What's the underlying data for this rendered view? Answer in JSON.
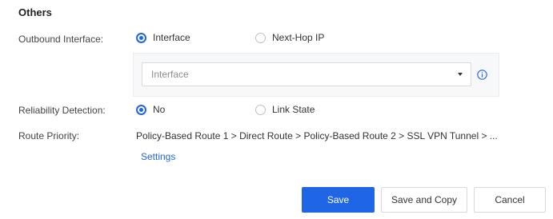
{
  "section": {
    "title": "Others"
  },
  "outbound": {
    "label": "Outbound Interface:",
    "options": [
      {
        "label": "Interface",
        "checked": true
      },
      {
        "label": "Next-Hop IP",
        "checked": false
      }
    ],
    "select": {
      "placeholder": "Interface"
    }
  },
  "reliability": {
    "label": "Reliability Detection:",
    "options": [
      {
        "label": "No",
        "checked": true
      },
      {
        "label": "Link State",
        "checked": false
      }
    ]
  },
  "route_priority": {
    "label": "Route Priority:",
    "value": "Policy-Based Route 1 > Direct Route > Policy-Based Route 2 > SSL VPN Tunnel > ...",
    "settings_link": "Settings"
  },
  "actions": {
    "save": "Save",
    "save_and_copy": "Save and Copy",
    "cancel": "Cancel"
  },
  "colors": {
    "accent": "#1f66e6"
  }
}
